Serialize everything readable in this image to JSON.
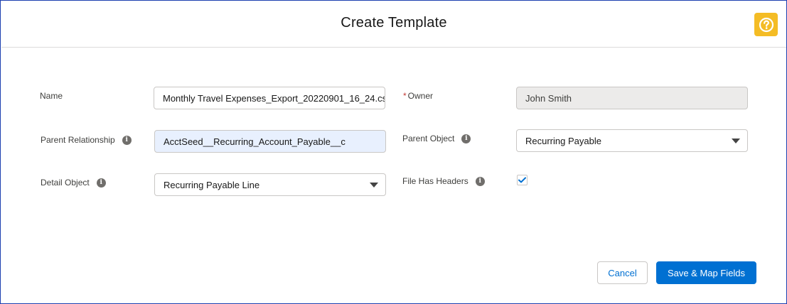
{
  "dialog": {
    "title": "Create Template",
    "help_icon": "question-icon"
  },
  "form": {
    "name": {
      "label": "Name",
      "value": "Monthly Travel Expenses_Export_20220901_16_24.cs"
    },
    "owner": {
      "required_marker": "*",
      "label": "Owner",
      "value": "John Smith"
    },
    "parent_relationship": {
      "label": "Parent Relationship",
      "value": "AcctSeed__Recurring_Account_Payable__c",
      "info_icon": "info-icon"
    },
    "parent_object": {
      "label": "Parent Object",
      "value": "Recurring Payable",
      "info_icon": "info-icon"
    },
    "detail_object": {
      "label": "Detail Object",
      "value": "Recurring Payable Line",
      "info_icon": "info-icon"
    },
    "file_has_headers": {
      "label": "File Has Headers",
      "checked": true,
      "info_icon": "info-icon"
    }
  },
  "footer": {
    "cancel_label": "Cancel",
    "save_label": "Save & Map Fields"
  },
  "colors": {
    "accent": "#0070d2",
    "help": "#f4bc25",
    "required": "#c23934"
  }
}
